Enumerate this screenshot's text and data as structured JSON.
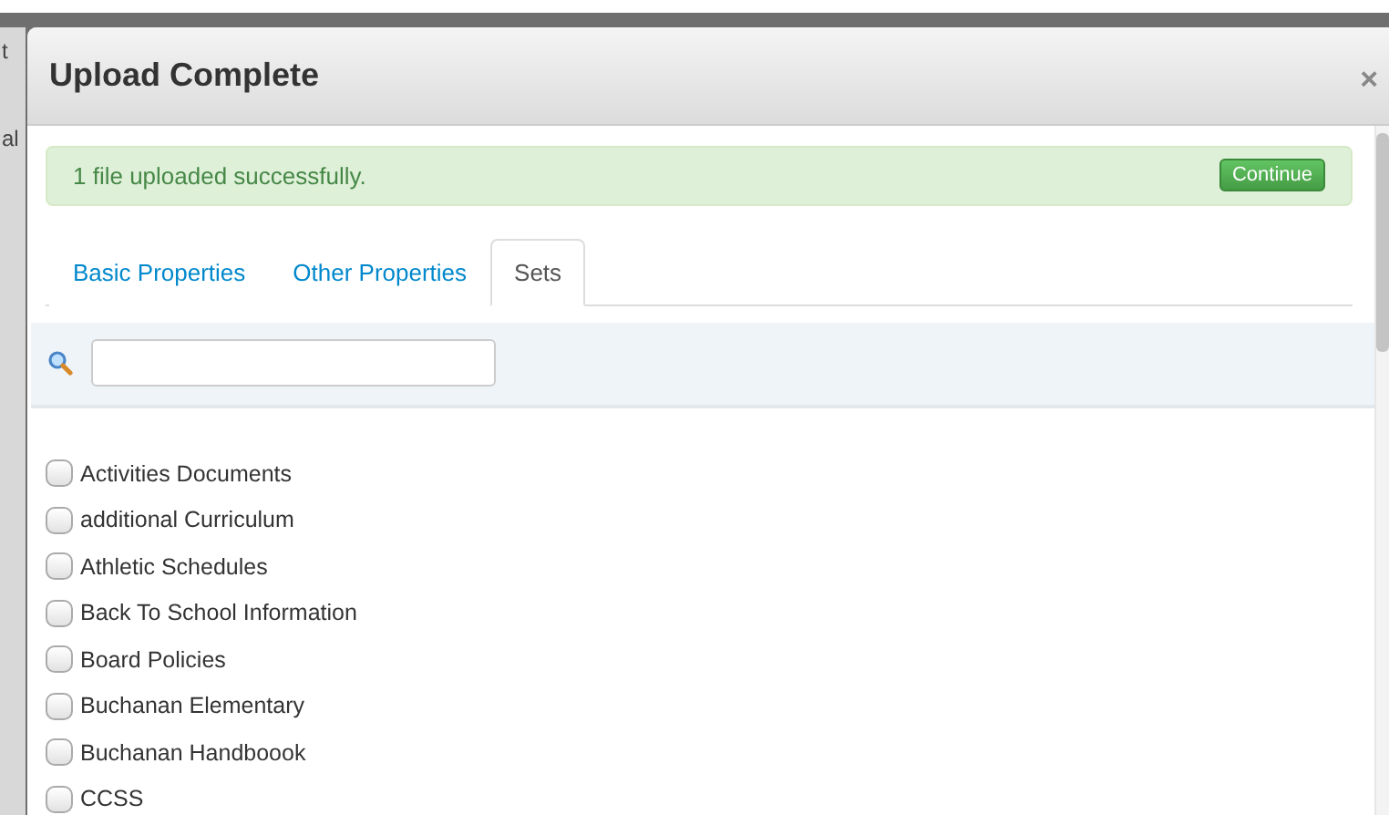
{
  "backdrop": {
    "fragments": [
      "t",
      "al"
    ]
  },
  "dialog": {
    "title": "Upload Complete",
    "close": "×"
  },
  "alert": {
    "message": "1 file uploaded successfully.",
    "button": "Continue"
  },
  "tabs": [
    {
      "label": "Basic Properties",
      "selected": false
    },
    {
      "label": "Other Properties",
      "selected": false
    },
    {
      "label": "Sets",
      "selected": true
    }
  ],
  "sets": [
    {
      "label": "Activities Documents",
      "checked": false
    },
    {
      "label": "additional Curriculum",
      "checked": false
    },
    {
      "label": "Athletic Schedules",
      "checked": false
    },
    {
      "label": "Back To School Information",
      "checked": false
    },
    {
      "label": "Board Policies",
      "checked": false
    },
    {
      "label": "Buchanan Elementary",
      "checked": false
    },
    {
      "label": "Buchanan Handboook",
      "checked": false
    },
    {
      "label": "CCSS",
      "checked": false
    }
  ]
}
